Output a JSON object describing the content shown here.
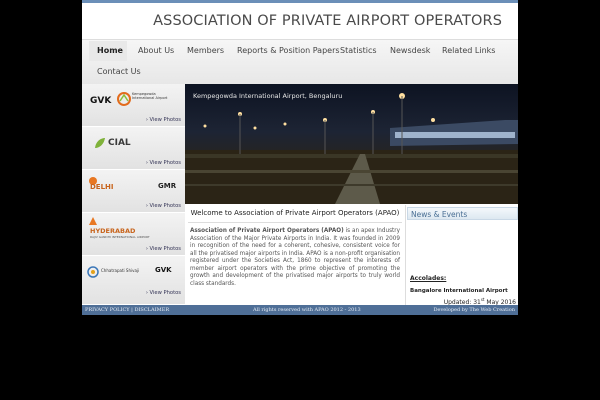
{
  "site": {
    "title": "ASSOCIATION OF PRIVATE AIRPORT OPERATORS"
  },
  "nav": {
    "items": [
      "Home",
      "About Us",
      "Members",
      "Reports & Position Papers",
      "Statistics",
      "Newsdesk",
      "Related Links",
      "Contact Us"
    ]
  },
  "members": {
    "view_photos": "View Photos",
    "logos": [
      {
        "name": "GVK",
        "sub": "Kempegowda International Airport"
      },
      {
        "name": "CIAL"
      },
      {
        "name": "DELHI",
        "sub": "GMR"
      },
      {
        "name": "HYDERABAD",
        "sub": "RAJIV GANDHI INTERNATIONAL AIRPORT"
      },
      {
        "name": "Chhatrapati Shivaji",
        "sub": "GVK"
      }
    ]
  },
  "banner": {
    "caption": "Kempegowda International Airport, Bengaluru"
  },
  "welcome": {
    "heading": "Welcome to Association of Private Airport Operators (APAO)",
    "lead": "Association of Private Airport Operators (APAO)",
    "body": " is an apex Industry Association of the Major Private Airports in India. It was founded in 2009 in recognition of the need for a coherent, cohesive, consistent voice for all the privatised major airports in India. APAO is a non-profit organisation registered under the Societies Act, 1860 to represent the interests of member airport operators with the prime objective of promoting the growth and development of the privatised major airports to truly world class standards."
  },
  "news": {
    "heading": "News & Events",
    "accolades": "Accolades:",
    "item": "Bangalore International Airport",
    "updated_prefix": "Updated: 31",
    "updated_sup": "st",
    "updated_suffix": " May 2016"
  },
  "footer": {
    "left": "PRIVACY POLICY | DISCLAIMER",
    "center": "All rights reserved with APAO 2012 - 2013",
    "right": "Developed by The Web Creation"
  },
  "colors": {
    "footer": "#4f6f97",
    "news_heading": "#4a6f94",
    "topline": "#6b8fb8"
  }
}
